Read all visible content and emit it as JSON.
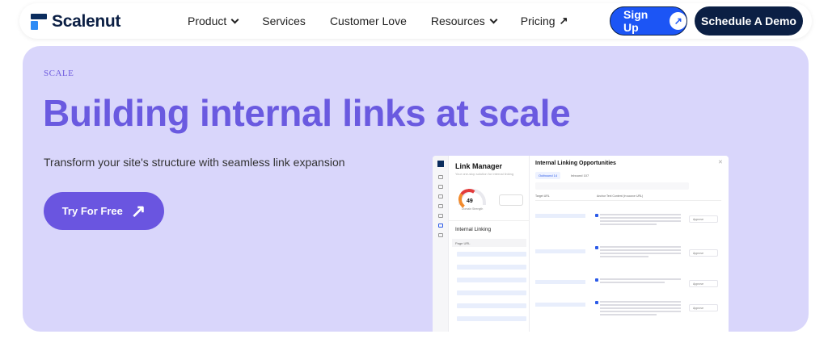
{
  "nav": {
    "brand": "Scalenut",
    "items": [
      {
        "label": "Product",
        "dropdown": true
      },
      {
        "label": "Services"
      },
      {
        "label": "Customer Love"
      },
      {
        "label": "Resources",
        "dropdown": true
      },
      {
        "label": "Pricing",
        "external": true
      }
    ],
    "signup_label": "Sign Up",
    "signup_icon": "↗",
    "demo_label": "Schedule A Demo"
  },
  "hero": {
    "eyebrow": "SCALE",
    "title": "Building internal links at scale",
    "subtitle": "Transform your site's structure with seamless link expansion",
    "cta_label": "Try For Free",
    "cta_icon": "↗"
  },
  "app": {
    "link_manager_title": "Link Manager",
    "link_manager_sub": "Your one-stop solution for internal linking",
    "gauge_value": "49",
    "gauge_label": "Domain Strength",
    "section_title": "Internal Linking",
    "page_url_header": "Page URL",
    "panel_title": "Internal Linking Opportunities",
    "tab_outbound": "Outbound 14",
    "tab_inbound": "Inbound 107",
    "col_target": "Target URL",
    "col_anchor": "Anchor Text Content (in source URL)",
    "approve_label": "Approve"
  },
  "colors": {
    "hero_bg": "#d9d6fb",
    "title": "#6a5ae0",
    "cta": "#6a55e0",
    "signup": "#1c55f5",
    "demo": "#0b1f44"
  }
}
